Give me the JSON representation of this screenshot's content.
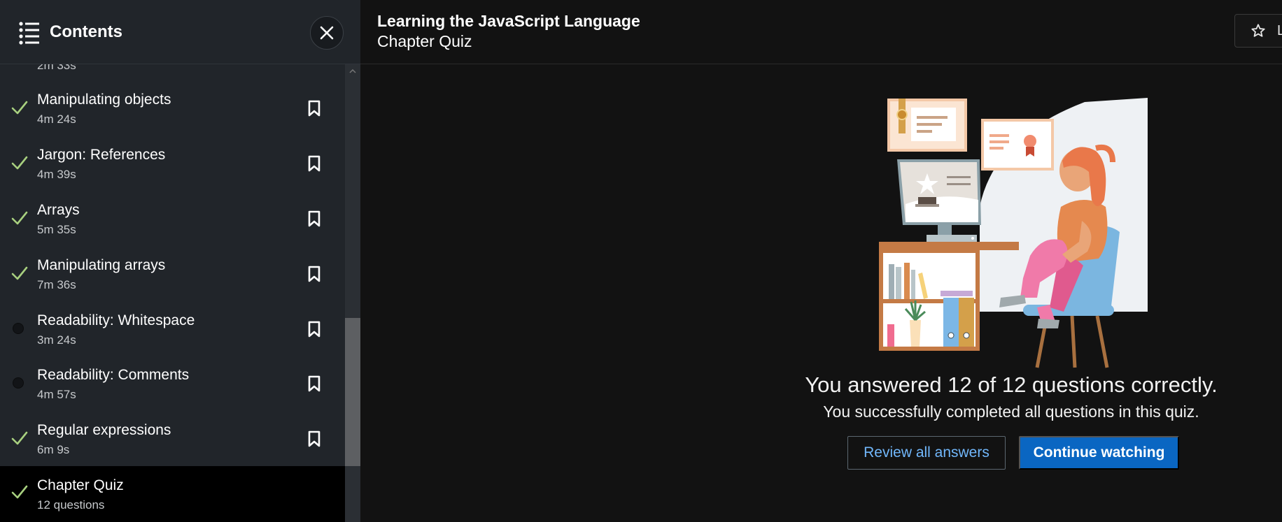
{
  "sidebar": {
    "title": "Contents",
    "partial_duration": "2m 33s",
    "items": [
      {
        "title": "Manipulating objects",
        "duration": "4m 24s",
        "status": "complete"
      },
      {
        "title": "Jargon: References",
        "duration": "4m 39s",
        "status": "complete"
      },
      {
        "title": "Arrays",
        "duration": "5m 35s",
        "status": "complete"
      },
      {
        "title": "Manipulating arrays",
        "duration": "7m 36s",
        "status": "complete"
      },
      {
        "title": "Readability: Whitespace",
        "duration": "3m 24s",
        "status": "incomplete"
      },
      {
        "title": "Readability: Comments",
        "duration": "4m 57s",
        "status": "incomplete"
      },
      {
        "title": "Regular expressions",
        "duration": "6m 9s",
        "status": "complete"
      },
      {
        "title": "Chapter Quiz",
        "duration": "12 questions",
        "status": "complete",
        "active": true
      }
    ]
  },
  "header": {
    "course_title": "Learning the JavaScript Language",
    "chapter_title": "Chapter Quiz",
    "save_label": "L"
  },
  "quiz": {
    "result": "You answered 12 of 12 questions correctly.",
    "subresult": "You successfully completed all questions in this quiz.",
    "review_label": "Review all answers",
    "continue_label": "Continue watching"
  },
  "colors": {
    "check": "#a8d07f",
    "accent": "#0a66c2",
    "link": "#71b7fb"
  }
}
